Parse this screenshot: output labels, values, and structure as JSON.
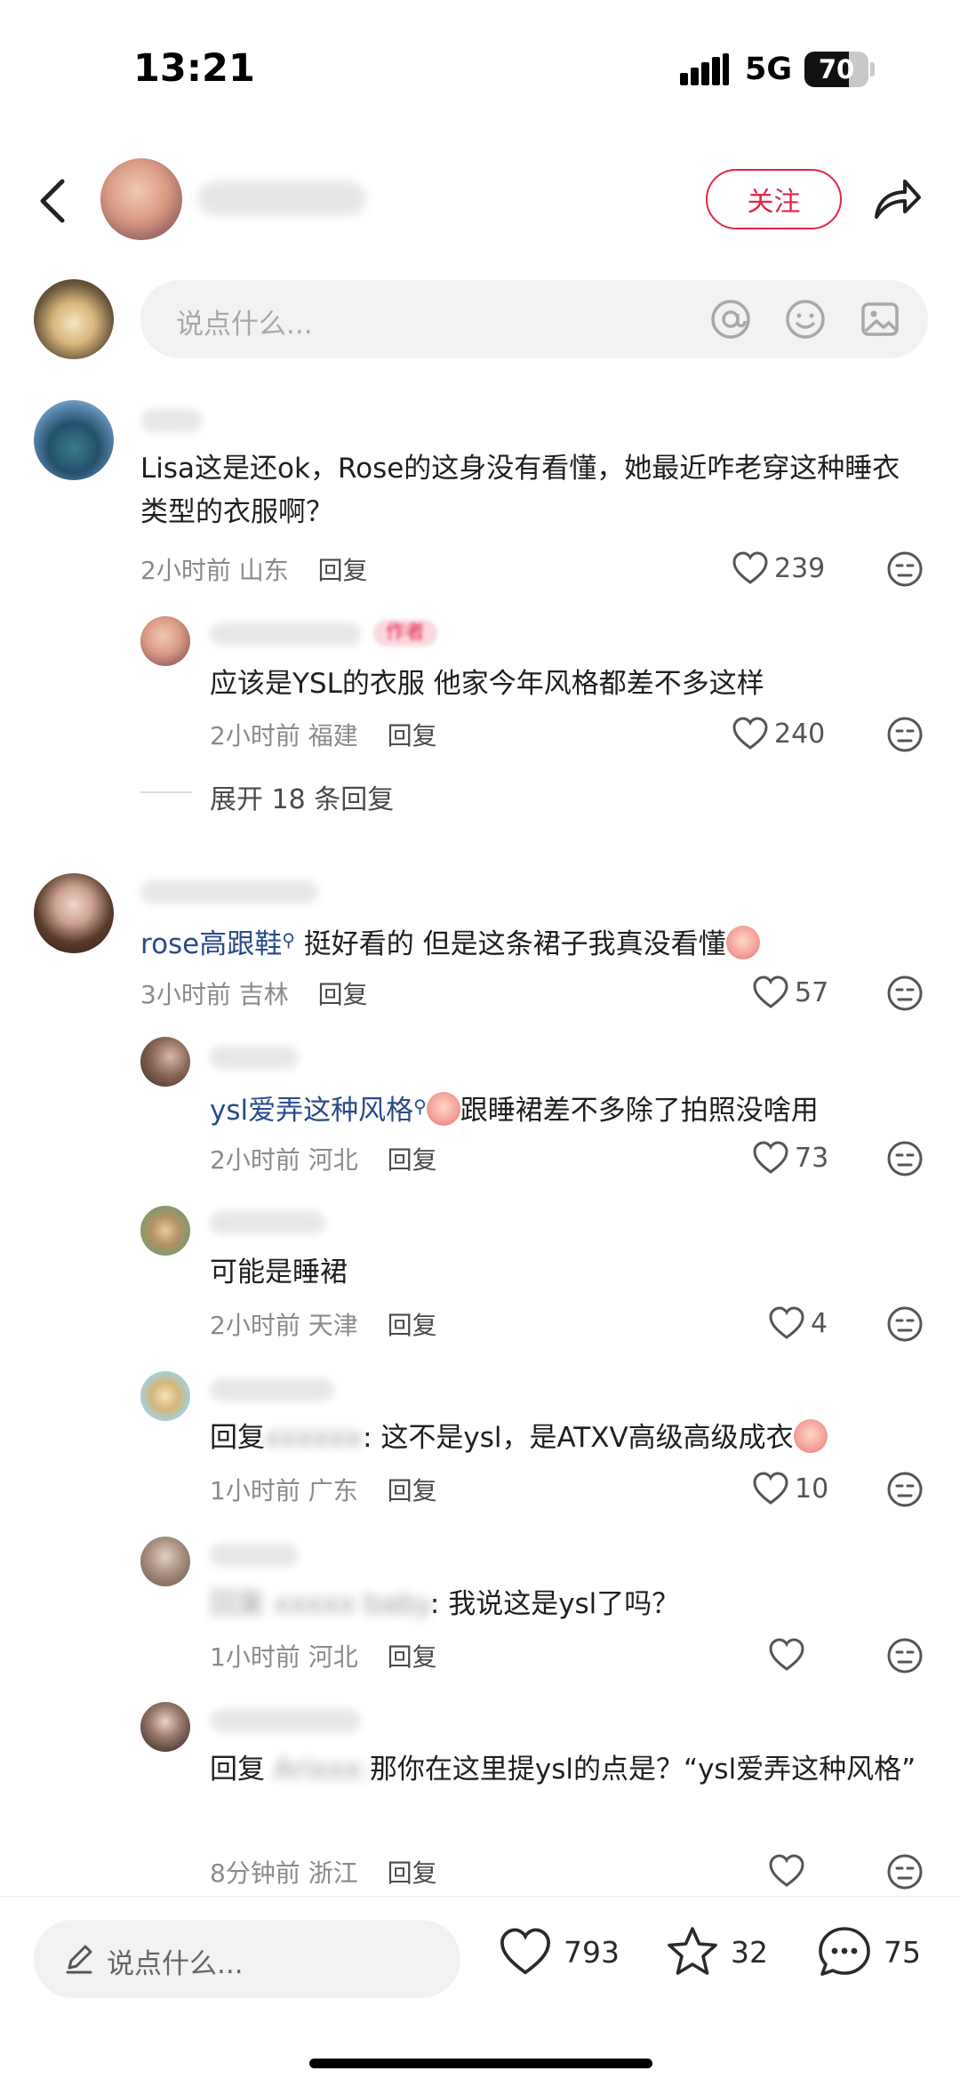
{
  "status_bar": {
    "time": "13:21",
    "network": "5G",
    "battery": "70"
  },
  "header": {
    "follow_label": "关注"
  },
  "top_input": {
    "placeholder": "说点什么..."
  },
  "comments": [
    {
      "text": "Lisa这是还ok，Rose的这身没有看懂，她最近咋老穿这种睡衣类型的衣服啊？",
      "time": "2小时前",
      "location": "山东",
      "reply": "回复",
      "likes": "239"
    },
    {
      "text": "应该是YSL的衣服 他家今年风格都差不多这样",
      "time": "2小时前",
      "location": "福建",
      "reply": "回复",
      "likes": "240",
      "badge": "作者"
    },
    {
      "tag": "rose高跟鞋",
      "text": " 挺好看的 但是这条裙子我真没看懂",
      "time": "3小时前",
      "location": "吉林",
      "reply": "回复",
      "likes": "57"
    },
    {
      "tag": "ysl爱弄这种风格",
      "text": "跟睡裙差不多除了拍照没啥用",
      "time": "2小时前",
      "location": "河北",
      "reply": "回复",
      "likes": "73"
    },
    {
      "text": "可能是睡裙",
      "time": "2小时前",
      "location": "天津",
      "reply": "回复",
      "likes": "4"
    },
    {
      "prefix": "回复",
      "text": ": 这不是ysl，是ATXV高级高级成衣",
      "time": "1小时前",
      "location": "广东",
      "reply": "回复",
      "likes": "10"
    },
    {
      "text": ": 我说这是ysl了吗？",
      "time": "1小时前",
      "location": "河北",
      "reply": "回复",
      "likes": ""
    },
    {
      "prefix": "回复",
      "text": "那你在这里提ysl的点是？“ysl爱弄这种风格”",
      "time": "8分钟前",
      "location": "浙江",
      "reply": "回复",
      "likes": ""
    }
  ],
  "expand_replies": "展开 18 条回复",
  "bottom_bar": {
    "placeholder": "说点什么...",
    "likes": "793",
    "favorites": "32",
    "comments": "75"
  },
  "colors": {
    "accent": "#e1254a",
    "tag": "#2a4a8a"
  }
}
